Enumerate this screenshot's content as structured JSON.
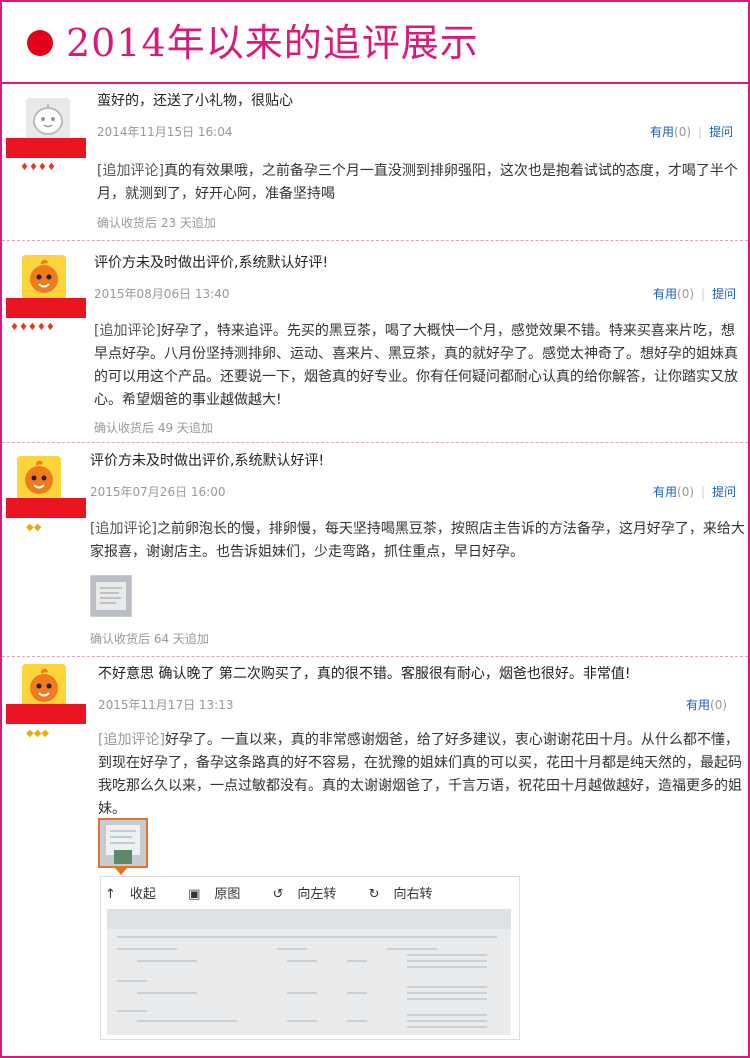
{
  "header": {
    "title": "2014年以来的追评展示"
  },
  "useful_label": "有用",
  "ask_label": "提问",
  "reviews": [
    {
      "text": "蛮好的，还送了小礼物，很贴心",
      "date": "2014年11月15日 16:04",
      "useful_count": "(0)",
      "follow_tag": "[追加评论]",
      "follow": "真的有效果哦，之前备孕三个月一直没测到排卵强阳，这次也是抱着试试的态度，才喝了半个月，就测到了，好开心阿，准备坚持喝",
      "confirm": "确认收货后 23 天追加"
    },
    {
      "text": "评价方未及时做出评价,系统默认好评!",
      "date": "2015年08月06日 13:40",
      "useful_count": "(0)",
      "follow_tag": "[追加评论]",
      "follow": "好孕了，特来追评。先买的黑豆茶，喝了大概快一个月，感觉效果不错。特来买喜来片吃，想早点好孕。八月份坚持测排卵、运动、喜来片、黑豆茶，真的就好孕了。感觉太神奇了。想好孕的姐妹真的可以用这个产品。还要说一下，烟爸真的好专业。你有任何疑问都耐心认真的给你解答，让你踏实又放心。希望烟爸的事业越做越大!",
      "confirm": "确认收货后 49 天追加"
    },
    {
      "text": "评价方未及时做出评价,系统默认好评!",
      "date": "2015年07月26日 16:00",
      "useful_count": "(0)",
      "follow_tag": "[追加评论]",
      "follow": "之前卵泡长的慢，排卵慢，每天坚持喝黑豆茶，按照店主告诉的方法备孕，这月好孕了，来给大家报喜，谢谢店主。也告诉姐妹们，少走弯路，抓住重点，早日好孕。",
      "confirm": "确认收货后 64 天追加"
    },
    {
      "text": "不好意思 确认晚了 第二次购买了，真的很不错。客服很有耐心，烟爸也很好。非常值!",
      "date": "2015年11月17日 13:13",
      "useful_count": "(0)",
      "follow_tag": "[追加评论]",
      "follow": "好孕了。一直以来，真的非常感谢烟爸，给了好多建议，衷心谢谢花田十月。从什么都不懂，到现在好孕了，备孕这条路真的好不容易，在犹豫的姐妹们真的可以买，花田十月都是纯天然的，最起码我吃那么久以来，一点过敏都没有。真的太谢谢烟爸了，千言万语，祝花田十月越做越好，造福更多的姐妹。"
    }
  ],
  "viewer": {
    "collapse": "收起",
    "original": "原图",
    "rotate_left": "向左转",
    "rotate_right": "向右转"
  }
}
